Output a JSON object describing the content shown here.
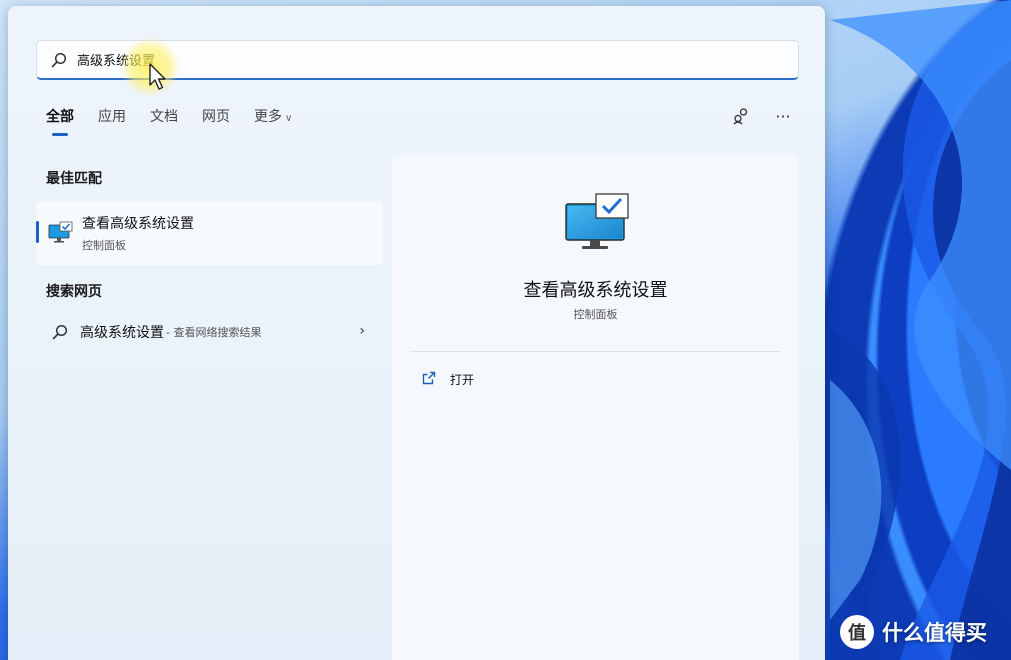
{
  "search": {
    "query": "高级系统设置",
    "placeholder": "",
    "icon": "search-icon"
  },
  "tabs": [
    {
      "label": "全部",
      "active": true
    },
    {
      "label": "应用",
      "active": false
    },
    {
      "label": "文档",
      "active": false
    },
    {
      "label": "网页",
      "active": false
    },
    {
      "label": "更多",
      "active": false,
      "has_dropdown": true
    }
  ],
  "tools": {
    "account_icon": "account-switch-icon",
    "more_label": "···"
  },
  "best_match": {
    "section_title": "最佳匹配",
    "title": "查看高级系统设置",
    "subtitle": "控制面板",
    "icon": "control-panel-monitor-icon"
  },
  "web_search": {
    "section_title": "搜索网页",
    "query": "高级系统设置",
    "suffix": " - 查看网络搜索结果",
    "chevron": "›"
  },
  "detail": {
    "title": "查看高级系统设置",
    "subtitle": "控制面板",
    "actions": [
      {
        "label": "打开",
        "icon": "open-external-icon"
      }
    ]
  },
  "watermark": {
    "text": "什么值得买",
    "logo_glyph": "值"
  },
  "colors": {
    "accent": "#1f5fbf",
    "panel_bg": "#eaf2fa",
    "monitor_blue": "#1e9be0"
  }
}
